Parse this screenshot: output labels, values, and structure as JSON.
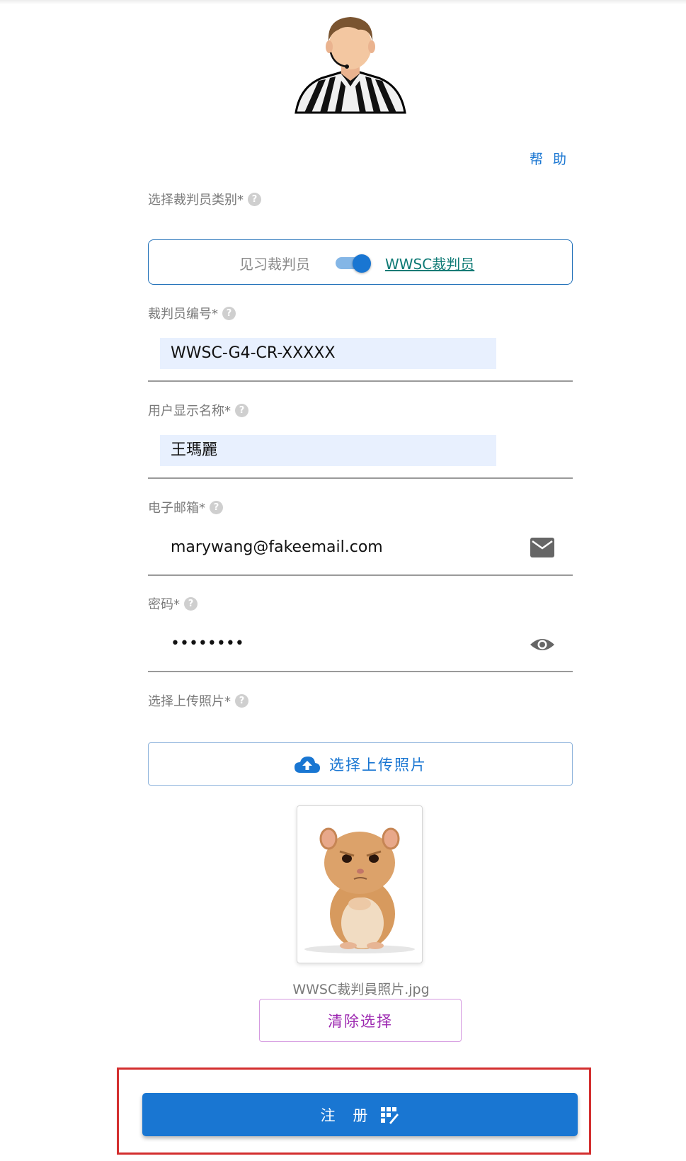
{
  "header": {
    "help_label": "帮 助"
  },
  "referee_type": {
    "label": "选择裁判员类别*",
    "option_left": "见习裁判员",
    "option_right": "WWSC裁判员",
    "selected": "WWSC裁判员"
  },
  "referee_id": {
    "label": "裁判员编号*",
    "value": "WWSC-G4-CR-XXXXX"
  },
  "display_name": {
    "label": "用户显示名称*",
    "value": "王瑪麗"
  },
  "email": {
    "label": "电子邮箱*",
    "value": "marywang@fakeemail.com"
  },
  "password": {
    "label": "密码*",
    "value": "••••••••"
  },
  "photo": {
    "label": "选择上传照片*",
    "upload_button": "选择上传照片",
    "file_name": "WWSC裁判員照片.jpg",
    "clear_button": "清除选择"
  },
  "submit": {
    "label": "注 册"
  },
  "icons": {
    "help": "question-circle-icon",
    "email": "envelope-icon",
    "password": "eye-icon",
    "upload": "cloud-upload-icon",
    "submit": "register-icon"
  },
  "colors": {
    "primary": "#1976d2",
    "secondary": "#9c27b0",
    "autofill": "#e8f0fe",
    "highlight": "#d32f2f",
    "link_teal": "#0e7a75"
  }
}
